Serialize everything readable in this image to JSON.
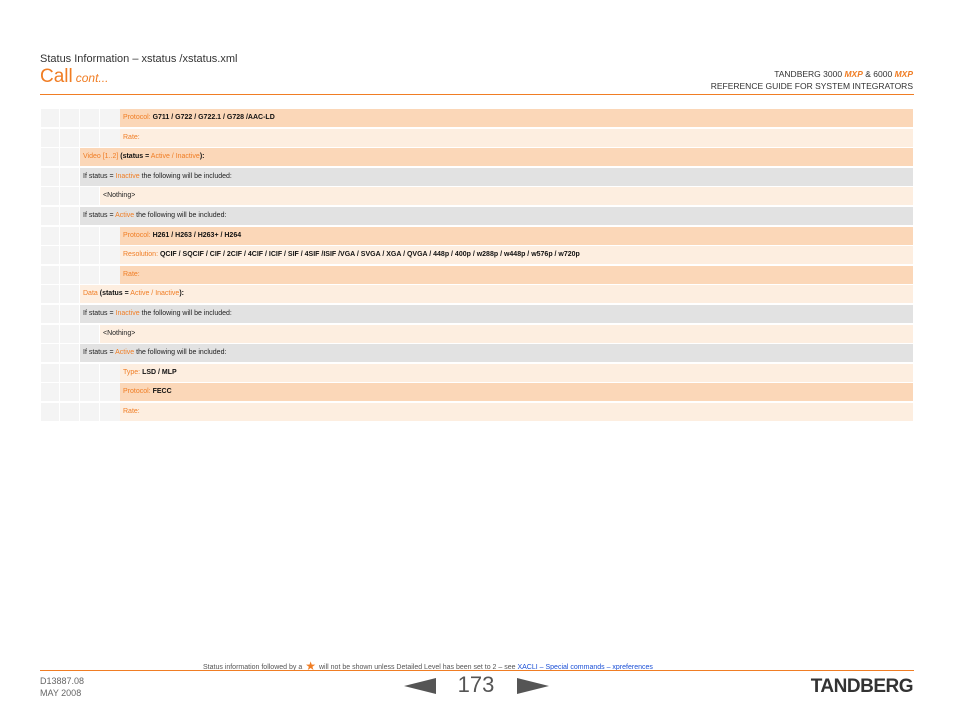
{
  "header": {
    "subtitle": "Status Information – xstatus /xstatus.xml",
    "title": "Call",
    "title_cont": "cont...",
    "product_line1_a": "TANDBERG 3000",
    "product_line1_mxp1": "MXP",
    "product_line1_amp": "&",
    "product_line1_b": "6000",
    "product_line1_mxp2": "MXP",
    "product_line2": "REFERENCE GUIDE FOR SYSTEM INTEGRATORS"
  },
  "rows": [
    {
      "label": "Protocol:",
      "value": "G711 / G722 / G722.1 / G728 /AAC-LD"
    },
    {
      "label": "Rate:"
    },
    {
      "label": "Video [1..2]",
      "open": "(status =",
      "values": "Active / Inactive",
      "close": "):"
    },
    {
      "pre": "If status =",
      "key": "Inactive",
      "post": "the following will be included:"
    },
    {
      "text": "<Nothing>"
    },
    {
      "pre": "If status =",
      "key": "Active",
      "post": "the following will be included:"
    },
    {
      "label": "Protocol:",
      "value": "H261 / H263 / H263+ / H264"
    },
    {
      "label": "Resolution:",
      "value": "QCIF / SQCIF / CIF / 2CIF / 4CIF / ICIF / SIF / 4SIF /ISIF /VGA / SVGA / XGA / QVGA / 448p / 400p / w288p / w448p / w576p / w720p"
    },
    {
      "label": "Rate:"
    },
    {
      "label": "Data",
      "open": "(status =",
      "values": "Active / Inactive",
      "close": "):"
    },
    {
      "pre": "If status =",
      "key": "Inactive",
      "post": "the following will be included:"
    },
    {
      "text": "<Nothing>"
    },
    {
      "pre": "If status =",
      "key": "Active",
      "post": "the following will be included:"
    },
    {
      "label": "Type:",
      "value": "LSD / MLP"
    },
    {
      "label": "Protocol:",
      "value": "FECC"
    },
    {
      "label": "Rate:"
    }
  ],
  "footer": {
    "note_pre": "Status information followed by a",
    "star": "★",
    "note_post": "will not be shown unless Detailed Level has been set to 2 – see",
    "link": "XACLI – Special commands – xpreferences",
    "doc_id": "D13887.08",
    "doc_date": "MAY 2008",
    "page": "173",
    "logo": "TANDBERG"
  },
  "colors": {
    "accent": "#f07d24",
    "row_orange": "#fbd7b8",
    "row_light": "#fdeee0",
    "row_grey": "#e2e2e2"
  }
}
